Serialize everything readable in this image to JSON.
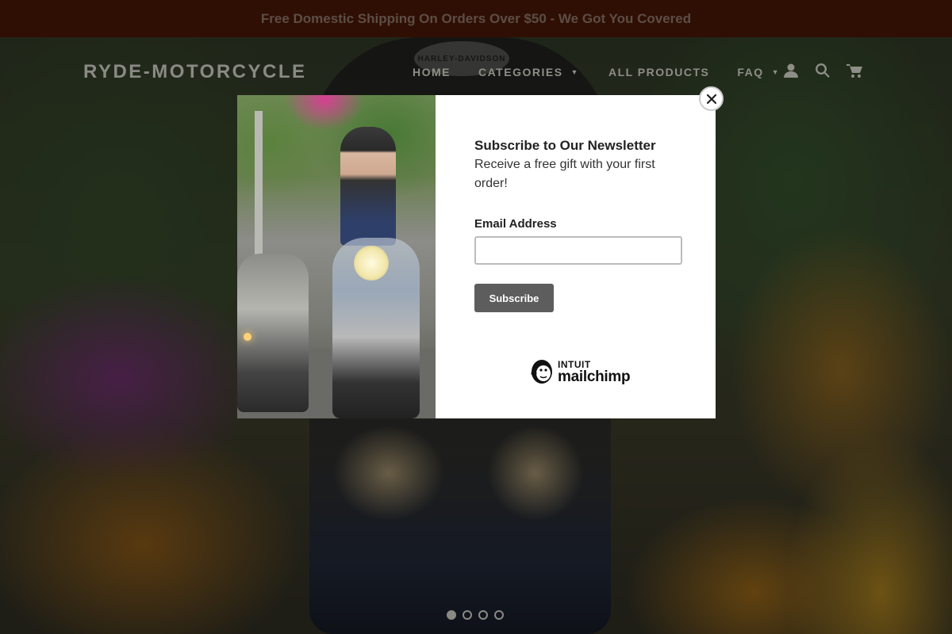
{
  "announcement": {
    "text": "Free Domestic Shipping On Orders Over $50 - We Got You Covered"
  },
  "header": {
    "brand": "RYDE-MOTORCYCLE",
    "nav": [
      {
        "label": "HOME"
      },
      {
        "label": "CATEGORIES",
        "has_dropdown": true
      },
      {
        "label": "ALL PRODUCTS"
      },
      {
        "label": "FAQ",
        "has_dropdown": true
      }
    ],
    "icons": [
      "account-icon",
      "search-icon",
      "cart-icon"
    ]
  },
  "hero": {
    "logo_text": "HARLEY-DAVIDSON",
    "slides": 4,
    "active_slide": 1
  },
  "modal": {
    "title": "Subscribe to Our Newsletter",
    "subtitle": "Receive a free gift with your first order!",
    "email_label": "Email Address",
    "email_value": "",
    "subscribe_label": "Subscribe",
    "powered_by": {
      "brand": "INTUIT",
      "name": "mailchimp"
    }
  },
  "colors": {
    "announcement_bg": "#5e1f09",
    "button_bg": "#5d5d5d",
    "overlay": "rgba(0,0,0,0.5)"
  }
}
